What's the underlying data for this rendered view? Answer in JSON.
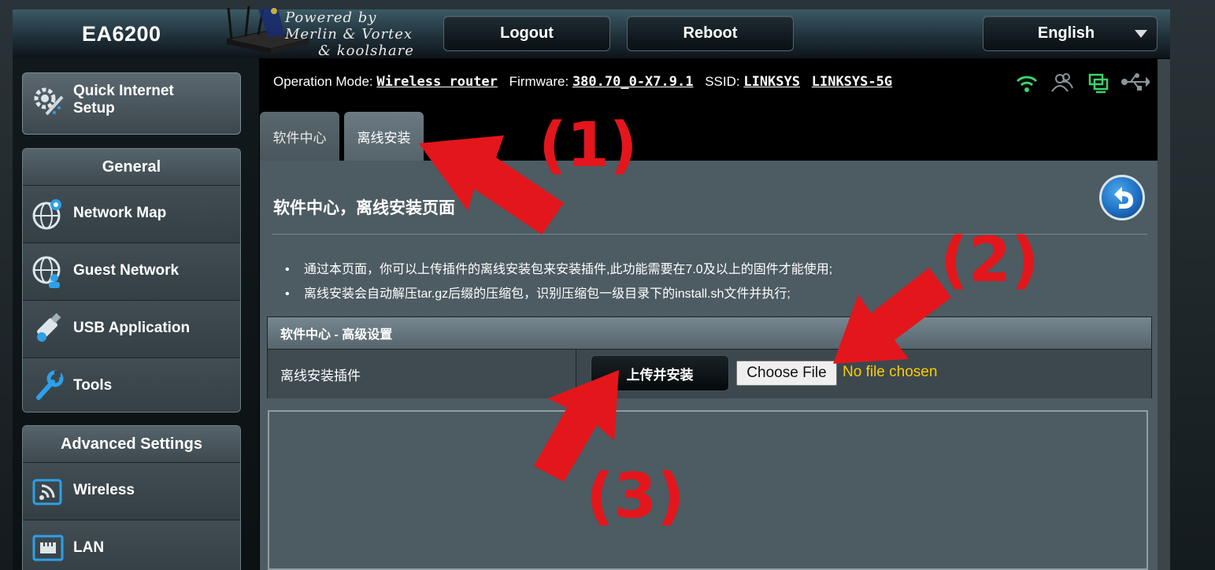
{
  "header": {
    "model": "EA6200",
    "powered_by": [
      "Powered by",
      "Merlin & Vortex",
      "& koolshare"
    ],
    "logout_label": "Logout",
    "reboot_label": "Reboot",
    "language_label": "English"
  },
  "sidebar": {
    "quick_setup_label": "Quick Internet Setup",
    "general": {
      "title": "General",
      "items": [
        {
          "label": "Network Map",
          "icon": "globe-pin-icon"
        },
        {
          "label": "Guest Network",
          "icon": "guest-globe-icon"
        },
        {
          "label": "USB Application",
          "icon": "usb-drive-icon"
        },
        {
          "label": "Tools",
          "icon": "wrench-icon"
        }
      ]
    },
    "advanced": {
      "title": "Advanced Settings",
      "items": [
        {
          "label": "Wireless",
          "icon": "wireless-icon"
        },
        {
          "label": "LAN",
          "icon": "lan-icon"
        }
      ]
    }
  },
  "status_bar": {
    "mode_label": "Operation Mode:",
    "mode_value": "Wireless router",
    "firmware_label": "Firmware:",
    "firmware_value": "380.70_0-X7.9.1",
    "ssid_label": "SSID:",
    "ssid_values": [
      "LINKSYS",
      "LINKSYS-5G"
    ],
    "icons": [
      "wifi-status-icon",
      "clients-icon",
      "network-status-icon",
      "usb-status-icon"
    ]
  },
  "tabs": [
    {
      "label": "软件中心"
    },
    {
      "label": "离线安装"
    }
  ],
  "main": {
    "title": "软件中心，离线安装页面",
    "bullets": [
      "通过本页面，你可以上传插件的离线安装包来安装插件,此功能需要在7.0及以上的固件才能使用;",
      "离线安装会自动解压tar.gz后缀的压缩包，识别压缩包一级目录下的install.sh文件并执行;"
    ],
    "table": {
      "header": "软件中心 - 高级设置",
      "row_label": "离线安装插件",
      "upload_button": "上传并安装",
      "choose_file": "Choose File",
      "no_file": "No file chosen"
    }
  },
  "annotations": [
    "(1)",
    "(2)",
    "(3)"
  ],
  "colors": {
    "accent_yellow": "#ffcc00",
    "annotation_red": "#e3161c",
    "panel": "#4d5b62"
  }
}
